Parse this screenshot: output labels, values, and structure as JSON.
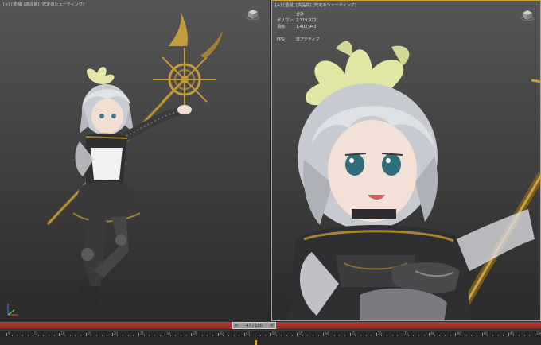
{
  "viewports": [
    {
      "label": "[+] [透視] [高品質] [既定のシェーディング]"
    },
    {
      "label": "[+] [透視] [高品質] [既定のシェーディング]"
    }
  ],
  "stats": {
    "header": "合計",
    "rows": [
      {
        "key": "ポリゴン:",
        "value": "2,319,922"
      },
      {
        "key": "頂点:",
        "value": "1,402,943"
      }
    ],
    "fps_key": "FPS:",
    "fps_value": "非アクティブ"
  },
  "timeline": {
    "current_frame": "47 / 100",
    "prev_arrow": "<",
    "next_arrow": ">",
    "ticks": [
      "0",
      "5",
      "10",
      "15",
      "20",
      "25",
      "30",
      "35",
      "40",
      "45",
      "50",
      "55",
      "60",
      "65",
      "70",
      "75",
      "80",
      "85",
      "90",
      "95",
      "100"
    ]
  },
  "colors": {
    "slider_red": "#b23a3a",
    "active_viewport_border": "#d2a33a",
    "key_gold": "#d8b14a"
  }
}
